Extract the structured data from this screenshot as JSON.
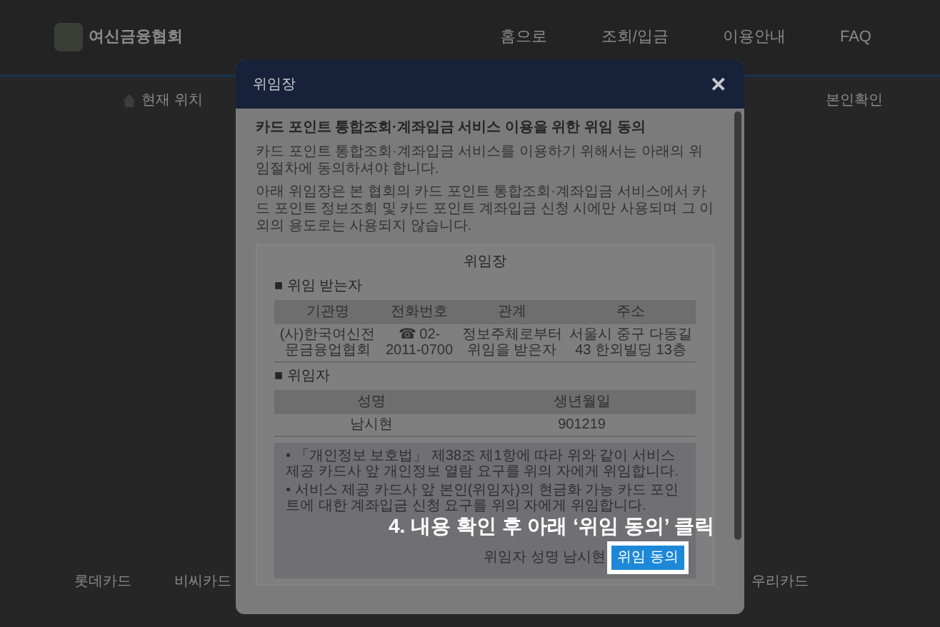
{
  "site": {
    "logo_text": "여신금융협회",
    "nav": [
      "홈으로",
      "조회/입금",
      "이용안내",
      "FAQ"
    ],
    "breadcrumb": "현재 위치",
    "page_label": "본인확인"
  },
  "modal": {
    "title": "위임장",
    "close": "✕",
    "heading": "카드 포인트 통합조회·계좌입금 서비스 이용을 위한 위임 동의",
    "paragraphs": [
      "카드 포인트 통합조회·계좌입금 서비스를 이용하기 위해서는 아래의 위임절차에 동의하셔야 합니다.",
      "아래 위임장은 본 협회의 카드 포인트 통합조회·계좌입금 서비스에서 카드 포인트 정보조회 및 카드 포인트 계좌입금 신청 시에만 사용되며 그 이외의 용도로는 사용되지 않습니다."
    ],
    "document": {
      "title": "위임장",
      "sections": [
        {
          "title": "■ 위임 받는자",
          "columns": [
            "기관명",
            "전화번호",
            "관계",
            "주소"
          ],
          "rows": [
            [
              "(사)한국여신전문금융업협회",
              "☎ 02-2011-0700",
              "정보주체로부터 위임을 받은자",
              "서울시 중구 다동길 43 한외빌딩 13층"
            ]
          ]
        },
        {
          "title": "■ 위임자",
          "columns": [
            "성명",
            "생년월일"
          ],
          "rows": [
            [
              "남시현",
              "901219"
            ]
          ]
        }
      ],
      "notices": [
        "• 「개인정보 보호법」 제38조 제1항에 따라 위와 같이 서비스 제공 카드사 앞 개인정보 열람 요구를 위의 자에게 위임합니다.",
        "• 서비스 제공 카드사 앞 본인(위임자)의 현금화 가능 카드 포인트에 대한 계좌입금 신청 요구를 위의 자에게 위임합니다."
      ],
      "signer": "위임자 성명 남시현",
      "agree_button": "위임 동의"
    }
  },
  "annotation": "4. 내용 확인 후 아래 ‘위임 동의’ 클릭",
  "footer_logos": [
    "롯데카드",
    "비씨카드",
    "우리카드"
  ]
}
